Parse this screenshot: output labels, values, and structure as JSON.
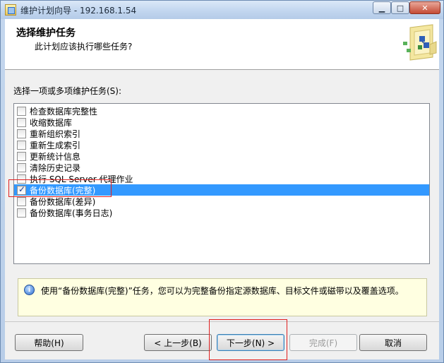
{
  "window": {
    "title": "维护计划向导 - 192.168.1.54"
  },
  "header": {
    "title": "选择维护任务",
    "subtitle": "此计划应该执行哪些任务?"
  },
  "body": {
    "select_label": "选择一项或多项维护任务(S):",
    "tasks": [
      {
        "label": "检查数据库完整性",
        "checked": false,
        "selected": false
      },
      {
        "label": "收缩数据库",
        "checked": false,
        "selected": false
      },
      {
        "label": "重新组织索引",
        "checked": false,
        "selected": false
      },
      {
        "label": "重新生成索引",
        "checked": false,
        "selected": false
      },
      {
        "label": "更新统计信息",
        "checked": false,
        "selected": false
      },
      {
        "label": "清除历史记录",
        "checked": false,
        "selected": false
      },
      {
        "label": "执行 SQL Server 代理作业",
        "checked": false,
        "selected": false
      },
      {
        "label": "备份数据库(完整)",
        "checked": true,
        "selected": true
      },
      {
        "label": "备份数据库(差异)",
        "checked": false,
        "selected": false
      },
      {
        "label": "备份数据库(事务日志)",
        "checked": false,
        "selected": false
      }
    ],
    "info_text": "使用“备份数据库(完整)”任务，您可以为完整备份指定源数据库、目标文件或磁带以及覆盖选项。"
  },
  "footer": {
    "help_label": "帮助(H)",
    "prev_label": "< 上一步(B)",
    "next_label": "下一步(N) >",
    "finish_label": "完成(F)",
    "cancel_label": "取消"
  },
  "colors": {
    "selection": "#3399ff",
    "highlight": "#e02020",
    "info_background": "#ffffe1"
  }
}
